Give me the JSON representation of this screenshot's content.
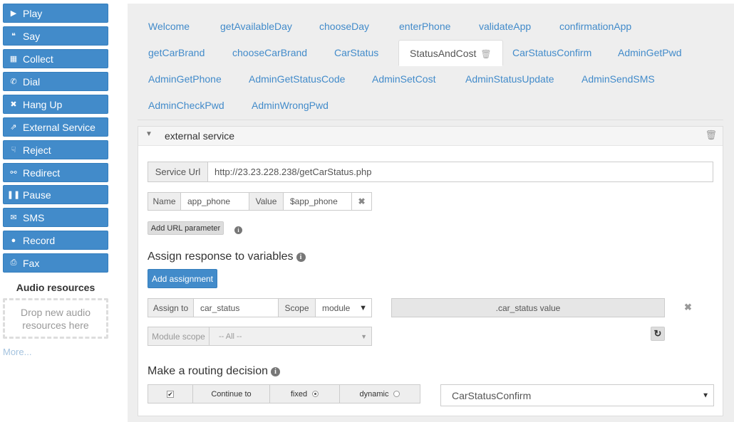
{
  "sidebar": {
    "verbs": [
      {
        "label": "Play",
        "icon": "play-icon",
        "glyph": "▶"
      },
      {
        "label": "Say",
        "icon": "quote-icon",
        "glyph": "❝"
      },
      {
        "label": "Collect",
        "icon": "grid-icon",
        "glyph": "▦"
      },
      {
        "label": "Dial",
        "icon": "phone-icon",
        "glyph": "✆"
      },
      {
        "label": "Hang Up",
        "icon": "close-icon",
        "glyph": "✖"
      },
      {
        "label": "External Service",
        "icon": "external-link-icon",
        "glyph": "⇗"
      },
      {
        "label": "Reject",
        "icon": "thumbs-down-icon",
        "glyph": "☟"
      },
      {
        "label": "Redirect",
        "icon": "link-icon",
        "glyph": "⚯"
      },
      {
        "label": "Pause",
        "icon": "pause-icon",
        "glyph": "❚❚"
      },
      {
        "label": "SMS",
        "icon": "envelope-icon",
        "glyph": "✉"
      },
      {
        "label": "Record",
        "icon": "microphone-icon",
        "glyph": "●"
      },
      {
        "label": "Fax",
        "icon": "print-icon",
        "glyph": "⎙"
      }
    ],
    "audio_title": "Audio resources",
    "dropzone_text": "Drop new audio resources here",
    "more_link": "More..."
  },
  "tabs": [
    {
      "label": "Welcome"
    },
    {
      "label": "getAvailableDay"
    },
    {
      "label": "chooseDay"
    },
    {
      "label": "enterPhone"
    },
    {
      "label": "validateApp"
    },
    {
      "label": "confirmationApp"
    },
    {
      "label": "getCarBrand"
    },
    {
      "label": "chooseCarBrand"
    },
    {
      "label": "CarStatus"
    },
    {
      "label": "StatusAndCost",
      "active": true
    },
    {
      "label": "CarStatusConfirm"
    },
    {
      "label": "AdminGetPwd"
    },
    {
      "label": "AdminGetPhone"
    },
    {
      "label": "AdminGetStatusCode"
    },
    {
      "label": "AdminSetCost"
    },
    {
      "label": "AdminStatusUpdate"
    },
    {
      "label": "AdminSendSMS"
    },
    {
      "label": "AdminCheckPwd"
    },
    {
      "label": "AdminWrongPwd"
    }
  ],
  "module": {
    "title": "external service",
    "service_url_label": "Service Url",
    "service_url_value": "http://23.23.228.238/getCarStatus.php",
    "param": {
      "name_label": "Name",
      "name_value": "app_phone",
      "value_label": "Value",
      "value_value": "$app_phone"
    },
    "add_param_label": "Add URL parameter",
    "assign_title": "Assign response to variables",
    "add_assignment_label": "Add assignment",
    "assignment": {
      "assign_label": "Assign to",
      "assign_value": "car_status",
      "scope_label": "Scope",
      "scope_value": "module",
      "expression": ".car_status value",
      "module_scope_label": "Module scope",
      "module_scope_value": "-- All --"
    },
    "routing_title": "Make a routing decision",
    "routing": {
      "continue_label": "Continue to",
      "fixed_label": "fixed",
      "dynamic_label": "dynamic",
      "target_value": "CarStatusConfirm"
    }
  }
}
